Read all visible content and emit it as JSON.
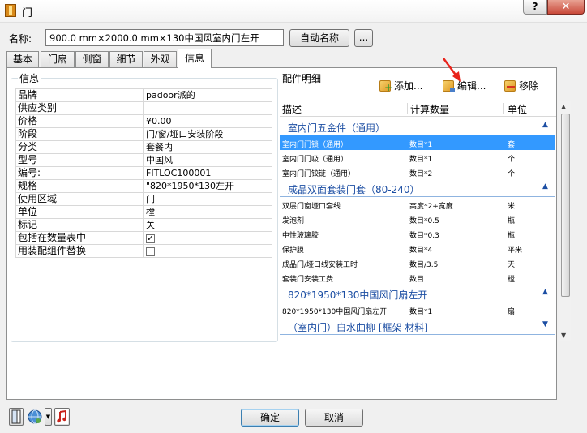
{
  "window": {
    "title": "门",
    "help": "?",
    "close": "✕"
  },
  "name_label": "名称:",
  "name_value": "900.0 mm×2000.0 mm×130中国风室内门左开",
  "auto_name_button": "自动名称",
  "browse_button": "...",
  "tabs": [
    {
      "label": "基本",
      "active": false
    },
    {
      "label": "门扇",
      "active": false
    },
    {
      "label": "侧窗",
      "active": false
    },
    {
      "label": "细节",
      "active": false
    },
    {
      "label": "外观",
      "active": false
    },
    {
      "label": "信息",
      "active": true
    }
  ],
  "info_group_title": "信息",
  "properties": [
    {
      "key": "品牌",
      "value": "padoor派的"
    },
    {
      "key": "供应类别",
      "value": ""
    },
    {
      "key": "价格",
      "value": "¥0.00"
    },
    {
      "key": "阶段",
      "value": "门/窗/垭口安装阶段"
    },
    {
      "key": "分类",
      "value": "套餐内"
    },
    {
      "key": "型号",
      "value": "中国风"
    },
    {
      "key": "编号:",
      "value": "FITLOC100001"
    },
    {
      "key": "规格",
      "value": "\"820*1950*130左开"
    },
    {
      "key": "使用区域",
      "value": "门"
    },
    {
      "key": "单位",
      "value": "樘"
    },
    {
      "key": "标记",
      "value": "关"
    },
    {
      "key": "包括在数量表中",
      "value": "",
      "checked": true
    },
    {
      "key": "用装配组件替换",
      "value": "",
      "checked": false
    }
  ],
  "parts_group_title": "配件明细",
  "toolbar": {
    "add": "添加...",
    "edit": "编辑...",
    "remove": "移除"
  },
  "columns": {
    "desc": "描述",
    "qty": "计算数量",
    "unit": "单位"
  },
  "groups": [
    {
      "title": "室内门五金件（通用）",
      "caret": "▲",
      "items": [
        {
          "desc": "室内门门锁（通用）",
          "qty": "数目*1",
          "unit": "套",
          "selected": true
        },
        {
          "desc": "室内门门吸（通用）",
          "qty": "数目*1",
          "unit": "个"
        },
        {
          "desc": "室内门门铰链（通用）",
          "qty": "数目*2",
          "unit": "个"
        }
      ]
    },
    {
      "title": "成品双面套装门套（80-240）",
      "caret": "▲",
      "items": [
        {
          "desc": "双层门窗垭口套线",
          "qty": "高度*2+宽度",
          "unit": "米"
        },
        {
          "desc": "发泡剂",
          "qty": "数目*0.5",
          "unit": "瓶"
        },
        {
          "desc": "中性玻璃胶",
          "qty": "数目*0.3",
          "unit": "瓶"
        },
        {
          "desc": "保护膜",
          "qty": "数目*4",
          "unit": "平米"
        },
        {
          "desc": "成品门/垭口线安装工时",
          "qty": "数目/3.5",
          "unit": "天"
        },
        {
          "desc": "套装门安装工费",
          "qty": "数目",
          "unit": "樘"
        }
      ]
    },
    {
      "title": "820*1950*130中国风门扇左开",
      "caret": "▲",
      "items": [
        {
          "desc": "820*1950*130中国风门扇左开",
          "qty": "数目*1",
          "unit": "扇"
        }
      ]
    },
    {
      "title": "（室内门）白水曲柳 [框架 材料]",
      "caret": "▼",
      "items": []
    }
  ],
  "ok_button": "确定",
  "cancel_button": "取消",
  "bottom_icons": [
    "door-icon",
    "globe-icon",
    "dropdown-icon",
    "music-icon"
  ]
}
